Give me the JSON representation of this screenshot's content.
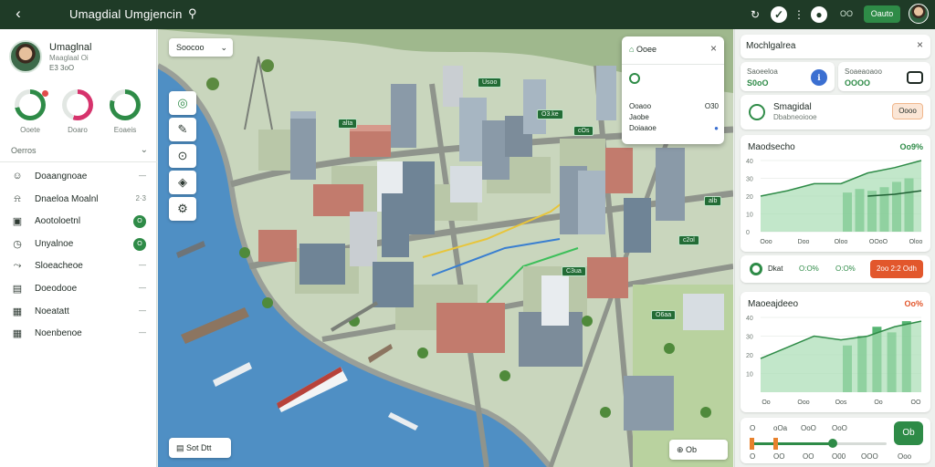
{
  "topbar": {
    "back_icon": "arrow-left-icon",
    "title": "Umagdial Umgjencin",
    "search_icon": "search-icon",
    "icons": [
      "refresh-icon",
      "shield-icon",
      "more-icon",
      "record-icon"
    ],
    "status_text": "OO",
    "main_button": "Oauto"
  },
  "profile": {
    "name": "Umaglnal",
    "subtitle": "Maaglaal Oi",
    "meta": "E3 3oO"
  },
  "rings": [
    {
      "label": "Ooete",
      "pct": 0.72,
      "color": "#2e8b47"
    },
    {
      "label": "Doaro",
      "pct": 0.55,
      "color": "#d6336c"
    },
    {
      "label": "Eoaeis",
      "pct": 0.8,
      "color": "#2e8b47"
    }
  ],
  "section": {
    "title": "Oerros"
  },
  "nav": [
    {
      "icon": "users-icon",
      "label": "Doaangnoae",
      "value": "—",
      "badge": ""
    },
    {
      "icon": "bell-icon",
      "label": "Dnaeloa Moalnl",
      "value": "2·3",
      "badge": ""
    },
    {
      "icon": "folder-icon",
      "label": "Aootoloetnl",
      "value": "",
      "badge": "O"
    },
    {
      "icon": "clock-icon",
      "label": "Unyalnoe",
      "value": "",
      "badge": "O"
    },
    {
      "icon": "route-icon",
      "label": "Sloeacheoe",
      "value": "—",
      "badge": ""
    },
    {
      "icon": "document-icon",
      "label": "Doeodooe",
      "value": "—",
      "badge": ""
    },
    {
      "icon": "report-icon",
      "label": "Noeatatt",
      "value": "—",
      "badge": ""
    },
    {
      "icon": "grid-icon",
      "label": "Noenbenoe",
      "value": "—",
      "badge": ""
    }
  ],
  "map": {
    "filter_label": "Soocoo",
    "tools": [
      "target-icon",
      "pencil-icon",
      "compass-icon",
      "layers-icon",
      "gear-icon"
    ],
    "legend_label": "Sot Dtt",
    "zoom_label": "Ob",
    "tags": [
      "alta",
      "Usoo",
      "O3.ke",
      "cOs",
      "c2ol",
      "C3ua",
      "O6aa",
      "alb"
    ],
    "popup": {
      "header": "Ooee",
      "rows": [
        {
          "label": "Ooaoo",
          "value": "O30"
        },
        {
          "label": "Jaobe",
          "value": ""
        },
        {
          "label": "Doiaaoe",
          "value": ""
        }
      ]
    }
  },
  "right": {
    "header": "Mochlgalrea",
    "kpis": [
      {
        "label": "Saoeeloa",
        "value": "S0oO"
      },
      {
        "label": "Soaeaoaoo",
        "value": "OOOO"
      }
    ],
    "alert": {
      "title": "Smagidal",
      "subtitle": "Dbabneoiooe",
      "button": "Oooo"
    },
    "chart1": {
      "title": "Maodsecho",
      "value": "Oo9%"
    },
    "legend1": {
      "label": "Dkat",
      "v1": "O:O%",
      "v2": "O:O%",
      "button": "2oo 2:2 Odh"
    },
    "chart2": {
      "title": "Maoeajdeeo",
      "value": "Oo%"
    },
    "slider": {
      "labels": [
        "O",
        "oOa",
        "OoO",
        "OoO"
      ],
      "nums": [
        "O",
        "OO",
        "OO",
        "O00",
        "OOO",
        "Ooo"
      ],
      "fab": "Ob"
    }
  },
  "chart_data": [
    {
      "type": "area",
      "title": "Maodsecho",
      "categories": [
        "Ooo",
        "Doo",
        "Oloo",
        "OOoO",
        "Oloo"
      ],
      "ylim": [
        0,
        40
      ],
      "y_ticks": [
        "0",
        "10",
        "20",
        "30",
        "40"
      ],
      "series": [
        {
          "values": [
            20,
            23,
            27,
            27,
            33,
            36,
            40
          ]
        },
        {
          "values": [
            0,
            0,
            0,
            0,
            20,
            21,
            23
          ]
        }
      ],
      "bars": [
        22,
        24,
        23,
        25,
        28,
        30
      ]
    },
    {
      "type": "area",
      "title": "Maoeajdeeo",
      "categories": [
        "Oo",
        "Ooo",
        "Oos",
        "Oo",
        "OO"
      ],
      "ylim": [
        0,
        40
      ],
      "y_ticks": [
        "10",
        "20",
        "30",
        "40"
      ],
      "series": [
        {
          "values": [
            18,
            24,
            30,
            28,
            30,
            35,
            38
          ]
        }
      ],
      "bars": [
        25,
        30,
        35,
        32,
        38
      ]
    }
  ]
}
